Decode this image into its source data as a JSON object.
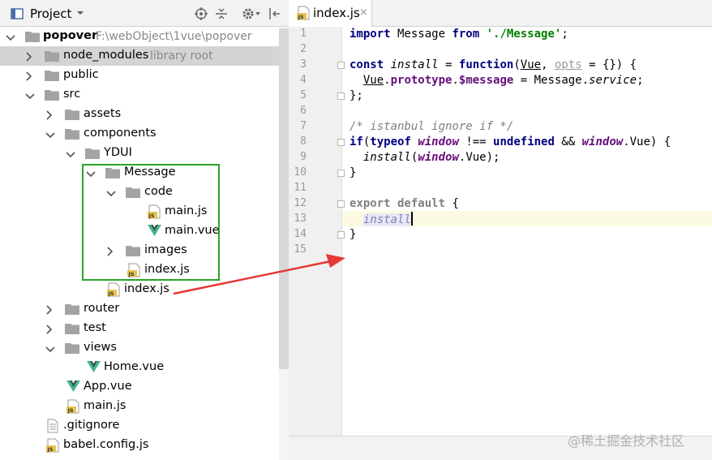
{
  "project_panel": {
    "title": "Project",
    "icons": [
      "project-view-icon",
      "dropdown-icon",
      "locate-icon",
      "collapse-icon",
      "settings-icon",
      "hide-icon"
    ]
  },
  "tree": {
    "root": {
      "name": "popover",
      "path": "F:\\webObject\\1vue\\popover"
    },
    "node_modules": {
      "name": "node_modules",
      "note": "library root"
    },
    "public": "public",
    "src": "src",
    "assets": "assets",
    "components": "components",
    "ydui": "YDUI",
    "message": "Message",
    "code": "code",
    "main_js_inner": "main.js",
    "main_vue": "main.vue",
    "images": "images",
    "index_js_inner": "index.js",
    "index_js_outer": "index.js",
    "router": "router",
    "test": "test",
    "views": "views",
    "home_vue": "Home.vue",
    "app_vue": "App.vue",
    "main_js": "main.js",
    "gitignore": ".gitignore",
    "babel_config": "babel.config.js"
  },
  "editor": {
    "tab_label": "index.js",
    "tab_close": "×",
    "line_numbers": [
      "1",
      "2",
      "3",
      "4",
      "5",
      "6",
      "7",
      "8",
      "9",
      "10",
      "11",
      "12",
      "13",
      "14",
      "15"
    ]
  },
  "watermark": "@稀土掘金技术社区",
  "colors": {
    "highlight_box": "#2aa52a",
    "annotation_arrow": "#e53935",
    "vue_green": "#41b883",
    "folder": "#a3a3a3",
    "js_badge": "#e7c34f"
  }
}
